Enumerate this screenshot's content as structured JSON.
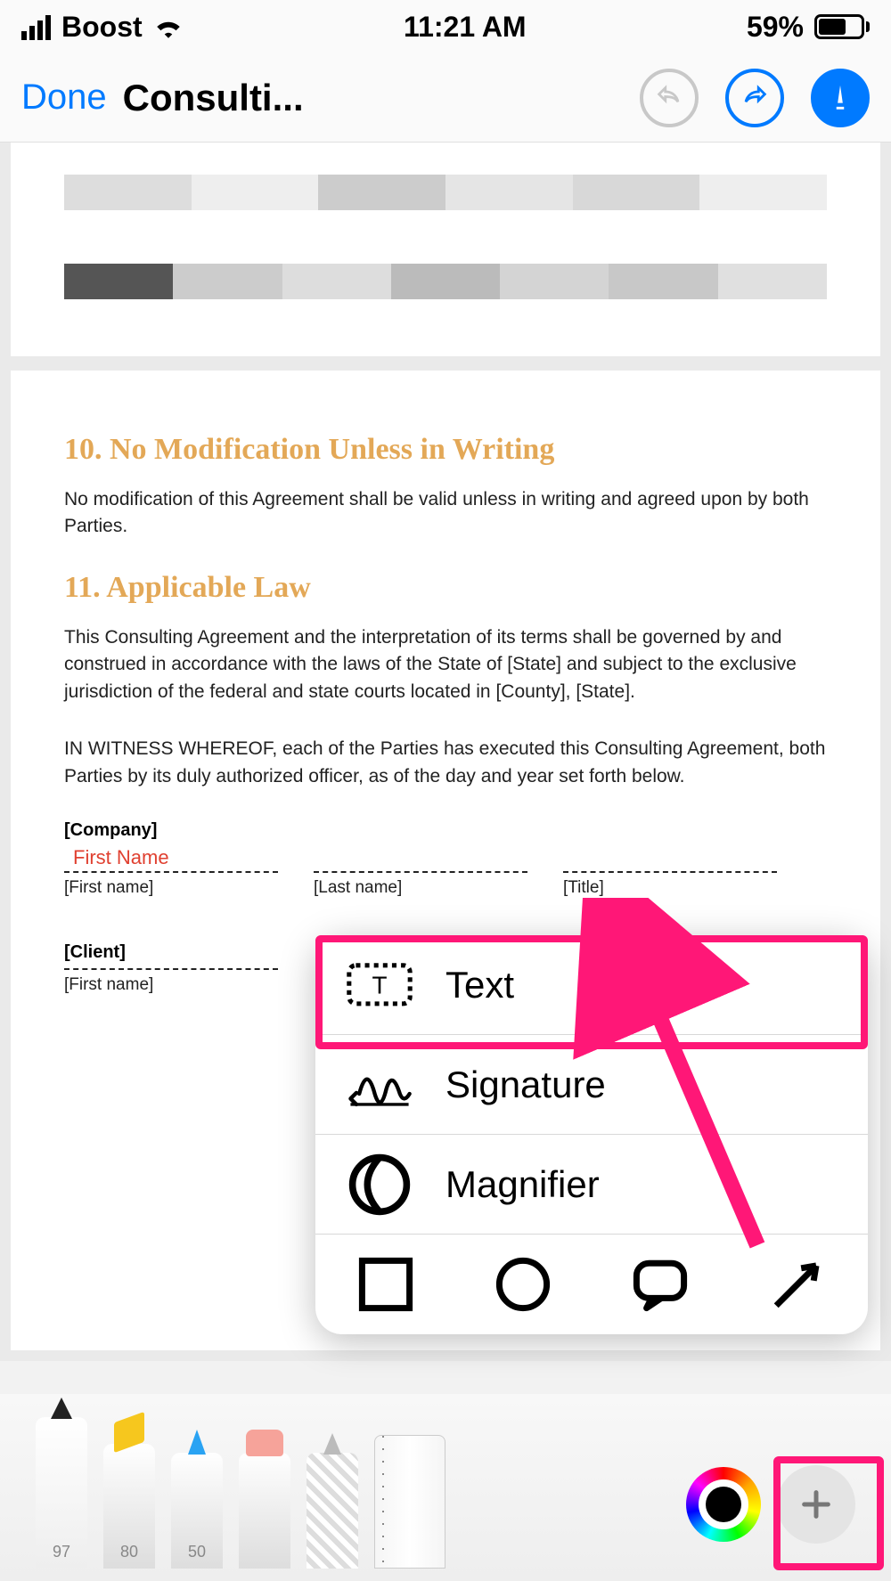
{
  "status": {
    "carrier": "Boost",
    "time": "11:21 AM",
    "battery_pct": "59%"
  },
  "nav": {
    "done": "Done",
    "title": "Consulti..."
  },
  "doc": {
    "sec10_heading": "10. No Modification Unless in Writing",
    "sec10_body": "No modification of this Agreement shall be valid unless in writing and agreed upon by both Parties.",
    "sec11_heading": "11. Applicable Law",
    "sec11_body1": "This Consulting Agreement and the interpretation of its terms shall be governed by and construed in accordance with the laws of the State of [State] and subject to the exclusive jurisdiction of the federal and state courts located in [County], [State].",
    "sec11_body2": "IN WITNESS WHEREOF, each of the Parties has executed this Consulting Agreement, both Parties by its duly authorized officer, as of the day and year set forth below.",
    "company_label": "[Company]",
    "first_name_input": "First Name",
    "first_name": "[First name]",
    "last_name": "[Last name]",
    "title": "[Title]",
    "client_label": "[Client]"
  },
  "popup": {
    "text": "Text",
    "signature": "Signature",
    "magnifier": "Magnifier"
  },
  "tools": {
    "pen": "97",
    "highlighter": "80",
    "pencil": "50"
  }
}
